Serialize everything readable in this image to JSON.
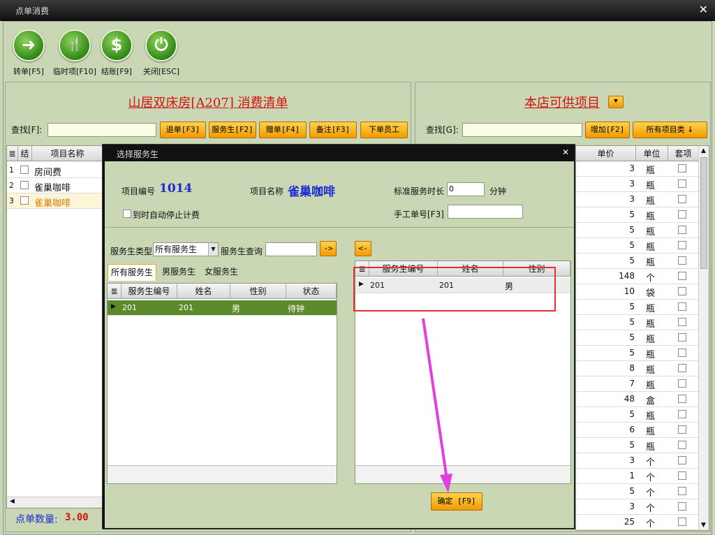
{
  "window": {
    "title": "点单消费",
    "close": "✕"
  },
  "toolbar": [
    {
      "label": "转单[F5]",
      "icon": "➜"
    },
    {
      "label": "临时项[F10]",
      "icon": "🍴"
    },
    {
      "label": "结账[F9]",
      "icon": "$"
    },
    {
      "label": "关闭[ESC]",
      "icon": "⏻"
    }
  ],
  "left": {
    "title": "山居双床房[A207] 消费清单",
    "search_label": "查找[F]:",
    "buttons": [
      "退单[F3]",
      "服务生[F2]",
      "赠单[F4]",
      "备注[F3]",
      "下单员工"
    ],
    "headers": [
      "结",
      "项目名称"
    ],
    "rows": [
      {
        "no": "1",
        "name": "房间费"
      },
      {
        "no": "2",
        "name": "雀巢咖啡"
      },
      {
        "no": "3",
        "name": "雀巢咖啡"
      }
    ],
    "count_label": "点单数量:",
    "count_value": "3.00"
  },
  "right": {
    "title": "本店可供项目",
    "search_label": "查找[G]:",
    "add_button": "增加[F2]",
    "category_button": "所有项目类 ↓",
    "headers": [
      "单价",
      "单位",
      "套项"
    ],
    "rows": [
      {
        "price": "3",
        "unit": "瓶"
      },
      {
        "price": "3",
        "unit": "瓶"
      },
      {
        "price": "3",
        "unit": "瓶"
      },
      {
        "price": "5",
        "unit": "瓶"
      },
      {
        "price": "5",
        "unit": "瓶"
      },
      {
        "price": "5",
        "unit": "瓶"
      },
      {
        "price": "5",
        "unit": "瓶"
      },
      {
        "price": "148",
        "unit": "个"
      },
      {
        "price": "10",
        "unit": "袋"
      },
      {
        "price": "5",
        "unit": "瓶"
      },
      {
        "price": "5",
        "unit": "瓶"
      },
      {
        "price": "5",
        "unit": "瓶"
      },
      {
        "price": "5",
        "unit": "瓶"
      },
      {
        "price": "8",
        "unit": "瓶"
      },
      {
        "price": "7",
        "unit": "瓶"
      },
      {
        "price": "48",
        "unit": "盒"
      },
      {
        "price": "5",
        "unit": "瓶"
      },
      {
        "price": "6",
        "unit": "瓶"
      },
      {
        "price": "5",
        "unit": "瓶"
      },
      {
        "price": "3",
        "unit": "个"
      },
      {
        "price": "1",
        "unit": "个"
      },
      {
        "price": "5",
        "unit": "个"
      },
      {
        "price": "3",
        "unit": "个"
      },
      {
        "price": "25",
        "unit": "个"
      }
    ]
  },
  "dialog": {
    "title": "选择服务生",
    "close": "✕",
    "item_no_label": "项目编号",
    "item_no": "1014",
    "item_name_label": "项目名称",
    "item_name": "雀巢咖啡",
    "std_duration_label": "标准服务时长",
    "std_duration": "0",
    "minutes": "分钟",
    "auto_stop_label": "到时自动停止计费",
    "manual_no_label": "手工单号[F3]",
    "waiter_type_label": "服务生类型",
    "waiter_type_value": "所有服务生",
    "waiter_query_label": "服务生查询",
    "arrow_right": "->",
    "arrow_left": "<-",
    "tabs": [
      "所有服务生",
      "男服务生",
      "女服务生"
    ],
    "left_headers": [
      "服务生编号",
      "姓名",
      "性别",
      "状态"
    ],
    "left_rows": [
      {
        "id": "201",
        "name": "201",
        "gender": "男",
        "status": "待钟"
      }
    ],
    "right_headers": [
      "服务生编号",
      "姓名",
      "性别"
    ],
    "right_rows": [
      {
        "id": "201",
        "name": "201",
        "gender": "男"
      }
    ],
    "confirm": "确定 [F9]"
  },
  "colors": {
    "accent": "#f29a00",
    "title_red": "#d41010",
    "highlight": "#e03030",
    "arrow": "#e040e0",
    "selected_row": "#5d8a2a"
  }
}
